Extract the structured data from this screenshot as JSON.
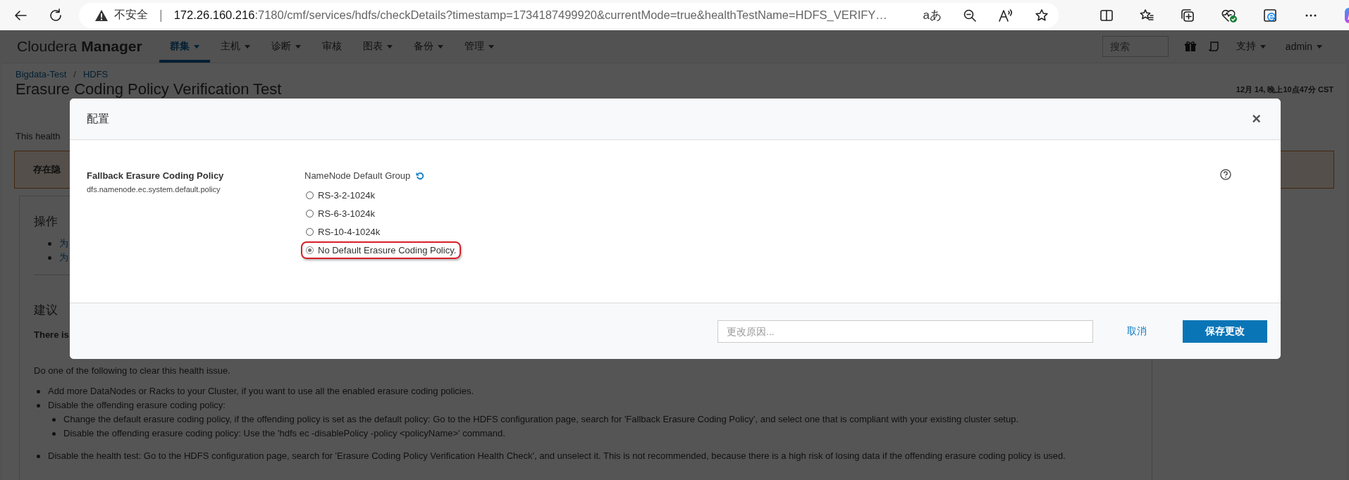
{
  "browser": {
    "warning": "不安全",
    "separator": "|",
    "url_host": "172.26.160.216",
    "url_rest": ":7180/cmf/services/hdfs/checkDetails?timestamp=1734187499920&currentMode=true&healthTestName=HDFS_VERIFY…",
    "translate_glyph": "aあ"
  },
  "nav": {
    "brand_light": "Cloudera",
    "brand_bold": "Manager",
    "menus": [
      {
        "label": "群集",
        "dropdown": true,
        "selected": true
      },
      {
        "label": "主机",
        "dropdown": true,
        "selected": false
      },
      {
        "label": "诊断",
        "dropdown": true,
        "selected": false
      },
      {
        "label": "审核",
        "dropdown": false,
        "selected": false
      },
      {
        "label": "图表",
        "dropdown": true,
        "selected": false
      },
      {
        "label": "备份",
        "dropdown": true,
        "selected": false
      },
      {
        "label": "管理",
        "dropdown": true,
        "selected": false
      }
    ],
    "search_placeholder": "搜索",
    "right_menus": [
      {
        "label": "支持",
        "dropdown": true
      },
      {
        "label": "admin",
        "dropdown": true
      }
    ]
  },
  "breadcrumb": {
    "items": [
      "Bigdata-Test",
      "HDFS"
    ],
    "separator": "/"
  },
  "page": {
    "title": "Erasure Coding Policy Verification Test",
    "timestamp": "12月 14, 晚上10点47分 CST",
    "intro": "This health",
    "alert": "存在隐",
    "actions_heading": "操作",
    "action_links": [
      "为",
      "为"
    ],
    "advice_heading": "建议",
    "advice_lead": "There is",
    "advice_intro": "Do one of the following to clear this health issue.",
    "advice_items": [
      {
        "text": "Add more DataNodes or Racks to your Cluster, if you want to use all the enabled erasure coding policies."
      },
      {
        "text": "Disable the offending erasure coding policy:",
        "children": [
          {
            "text": "Change the default erasure coding policy, if the offending policy is set as the default policy: Go to the HDFS configuration page, search for 'Fallback Erasure Coding Policy', and select one that is compliant with your existing cluster setup."
          },
          {
            "text": "Disable the offending erasure coding policy: Use the 'hdfs ec -disablePolicy -policy <policyName>' command."
          }
        ]
      },
      {
        "text": "Disable the health test: Go to the HDFS configuration page, search for 'Erasure Coding Policy Verification Health Check', and unselect it. This is not recommended, because there is a high risk of losing data if the offending erasure coding policy is used."
      }
    ]
  },
  "modal": {
    "title": "配置",
    "close": "×",
    "property_label": "Fallback Erasure Coding Policy",
    "property_key": "dfs.namenode.ec.system.default.policy",
    "group_label": "NameNode Default Group",
    "options": [
      {
        "label": "RS-3-2-1024k",
        "selected": false,
        "highlighted": false
      },
      {
        "label": "RS-6-3-1024k",
        "selected": false,
        "highlighted": false
      },
      {
        "label": "RS-10-4-1024k",
        "selected": false,
        "highlighted": false
      },
      {
        "label": "No Default Erasure Coding Policy.",
        "selected": true,
        "highlighted": true
      }
    ],
    "reason_placeholder": "更改原因...",
    "cancel": "取消",
    "save": "保存更改"
  }
}
